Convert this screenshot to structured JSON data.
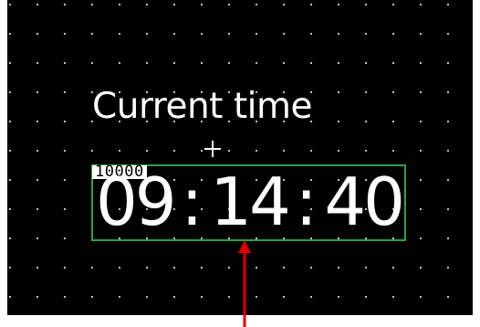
{
  "display": {
    "caption": "Current time",
    "widget_id": "10000",
    "time": {
      "hours": "09",
      "minutes": "14",
      "seconds": "40",
      "separator": ":"
    }
  },
  "colors": {
    "background": "#000000",
    "widget_border": "#31a04a",
    "annotation_arrow": "#e00000",
    "text": "#ffffff"
  },
  "icons": {
    "origin_marker": "plus-icon",
    "annotation": "arrow-up-icon"
  }
}
